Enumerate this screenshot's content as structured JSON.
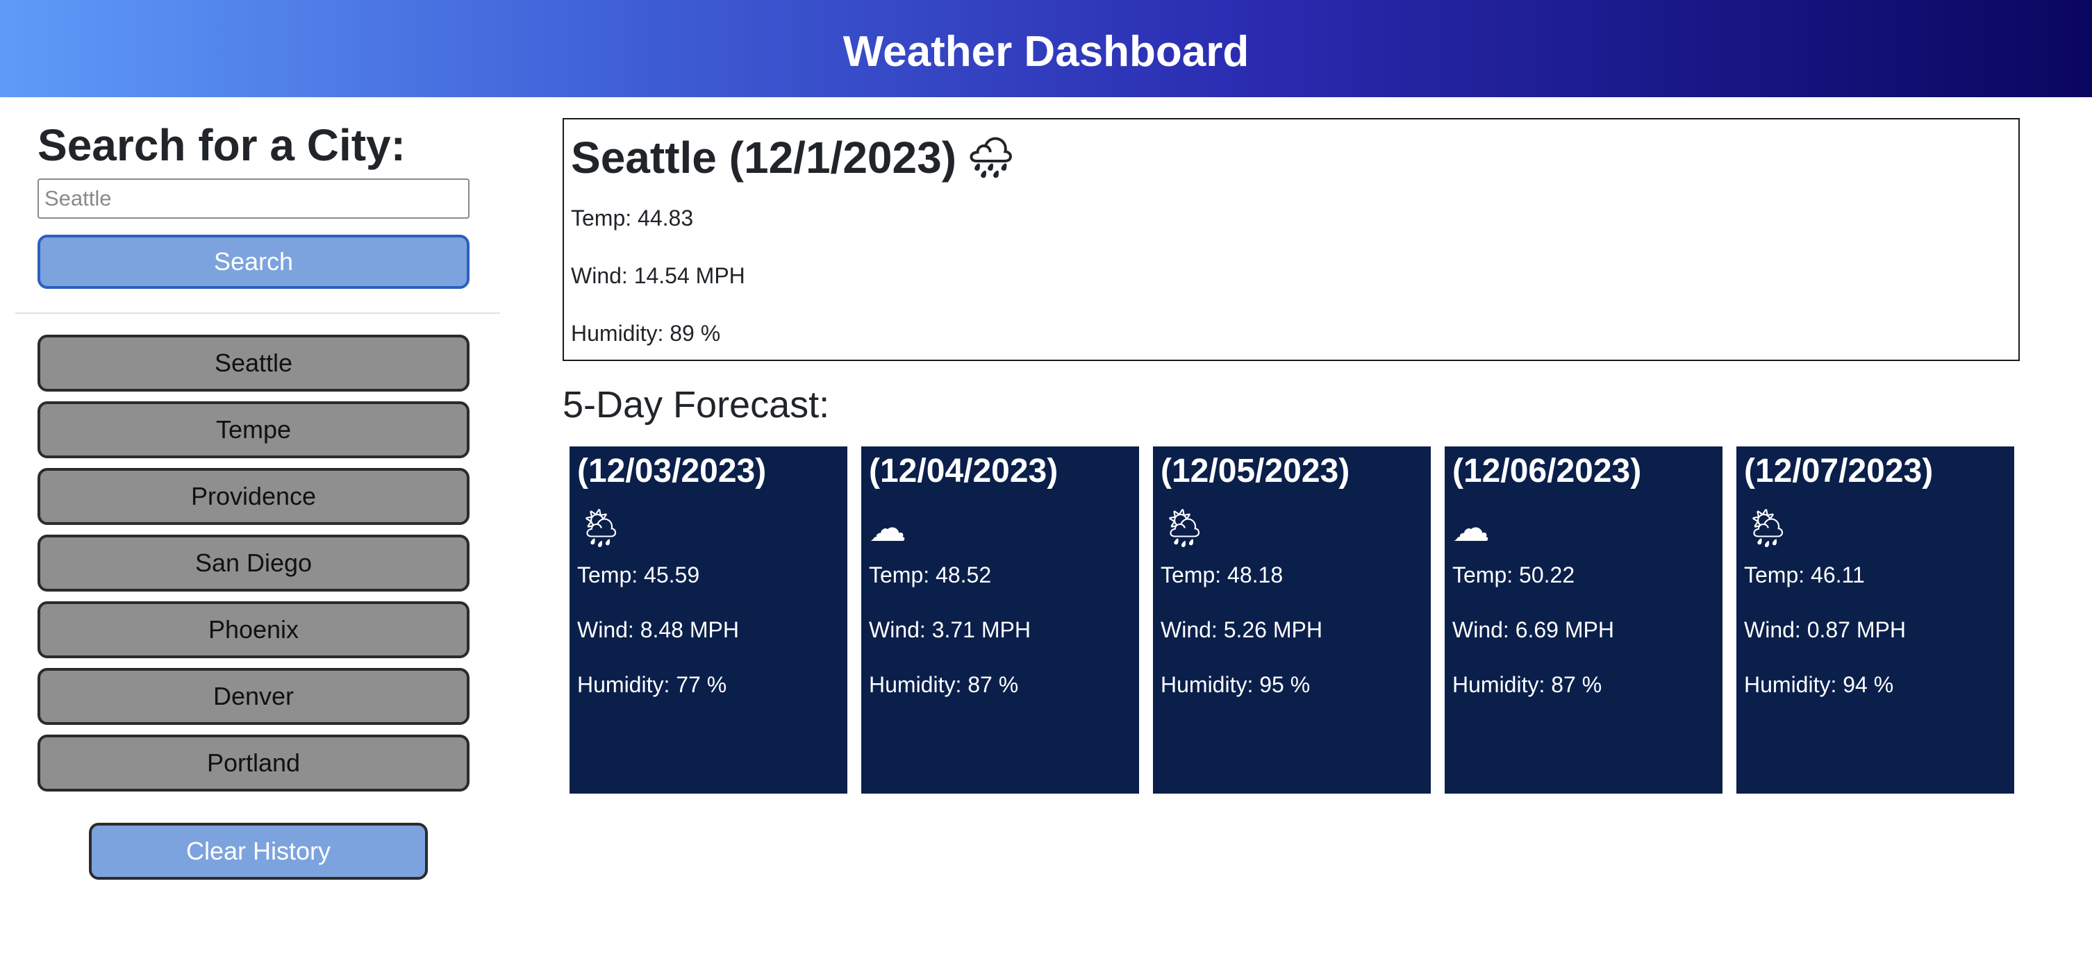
{
  "header": {
    "title": "Weather Dashboard"
  },
  "sidebar": {
    "title": "Search for a City:",
    "search": {
      "placeholder": "Seattle",
      "button_label": "Search"
    },
    "history": [
      "Seattle",
      "Tempe",
      "Providence",
      "San Diego",
      "Phoenix",
      "Denver",
      "Portland"
    ],
    "clear_label": "Clear History"
  },
  "current": {
    "heading": "Seattle (12/1/2023)",
    "icon": "rain-cloud-night-icon",
    "icon_glyph": "🌧",
    "temp": "Temp: 44.83",
    "wind": "Wind: 14.54 MPH",
    "humidity": "Humidity: 89 %"
  },
  "forecast": {
    "title": "5-Day Forecast:",
    "days": [
      {
        "date": "(12/03/2023)",
        "icon": "sun-rain-cloud-icon",
        "glyph": "🌦",
        "temp": "Temp: 45.59",
        "wind": "Wind: 8.48 MPH",
        "humidity": "Humidity: 77 %"
      },
      {
        "date": "(12/04/2023)",
        "icon": "cloud-icon",
        "glyph": "☁",
        "temp": "Temp: 48.52",
        "wind": "Wind: 3.71 MPH",
        "humidity": "Humidity: 87 %"
      },
      {
        "date": "(12/05/2023)",
        "icon": "sun-rain-cloud-icon",
        "glyph": "🌦",
        "temp": "Temp: 48.18",
        "wind": "Wind: 5.26 MPH",
        "humidity": "Humidity: 95 %"
      },
      {
        "date": "(12/06/2023)",
        "icon": "cloud-icon",
        "glyph": "☁",
        "temp": "Temp: 50.22",
        "wind": "Wind: 6.69 MPH",
        "humidity": "Humidity: 87 %"
      },
      {
        "date": "(12/07/2023)",
        "icon": "sun-rain-cloud-icon",
        "glyph": "🌦",
        "temp": "Temp: 46.11",
        "wind": "Wind: 0.87 MPH",
        "humidity": "Humidity: 94 %"
      }
    ]
  },
  "colors": {
    "card_bg": "#0b1f4b",
    "accent_button": "#7ca3dd",
    "history_button": "#8f8f8f"
  }
}
